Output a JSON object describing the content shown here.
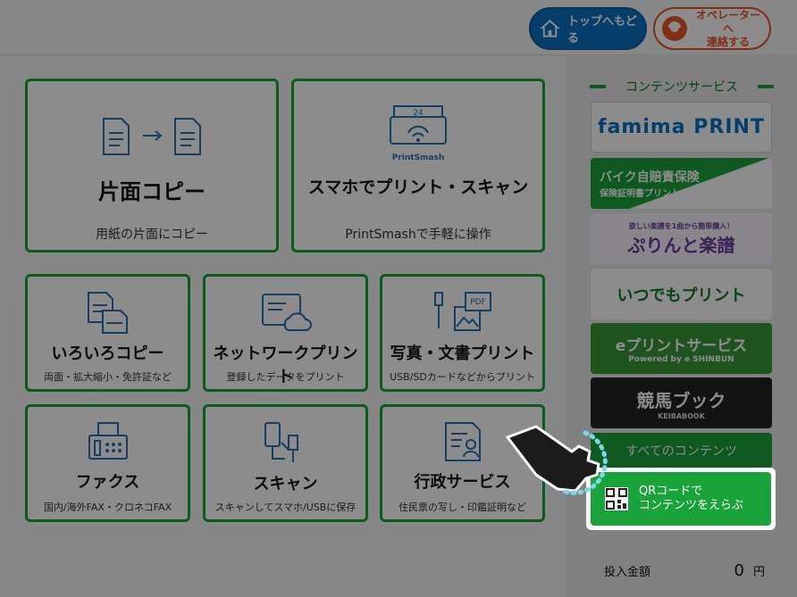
{
  "header": {
    "top_button": "トップへもどる",
    "operator_button_line1": "オペレーターへ",
    "operator_button_line2": "連絡する"
  },
  "tiles": [
    {
      "title": "片面コピー",
      "sub": "用紙の片面にコピー",
      "icon": "copy-document-icon"
    },
    {
      "title": "スマホでプリント・スキャン",
      "sub": "PrintSmashで手軽に操作",
      "icon": "printsmash-icon",
      "icon_label": "PrintSmash",
      "icon_number": "24"
    },
    {
      "title": "いろいろコピー",
      "sub": "両面・拡大縮小・免許証など",
      "icon": "multi-copy-icon"
    },
    {
      "title": "ネットワークプリント",
      "sub": "登録したデータをプリント",
      "icon": "cloud-print-icon"
    },
    {
      "title": "写真・文書プリント",
      "sub": "USB/SDカードなどからプリント",
      "icon": "photo-doc-icon",
      "icon_label": "PDF"
    },
    {
      "title": "ファクス",
      "sub": "国内/海外FAX・クロネコFAX",
      "icon": "fax-icon"
    },
    {
      "title": "スキャン",
      "sub": "スキャンしてスマホ/USBに保存",
      "icon": "scan-icon"
    },
    {
      "title": "行政サービス",
      "sub": "住民票の写し・印鑑証明など",
      "icon": "id-card-icon"
    }
  ],
  "content_services": {
    "title": "コンテンツサービス",
    "banners": [
      {
        "text": "famima PRINT",
        "colors": [
          "#ffffff",
          "#0b72c3",
          "#1aa33a"
        ]
      },
      {
        "text": "バイク自賠責保険",
        "text2": "保険証明書プリント"
      },
      {
        "text": "ぷりんと楽譜",
        "text2": "欲しい楽譜を1曲から簡単購入！"
      },
      {
        "text": "いつでもプリント"
      },
      {
        "text": "eプリントサービス",
        "text2": "Powered by e SHINBUN"
      },
      {
        "text": "競馬ブック",
        "text2": "KEIBABOOK"
      }
    ],
    "all_button": "すべてのコンテンツ",
    "qr_button_line1": "QRコードで",
    "qr_button_line2": "コンテンツをえらぶ"
  },
  "amount": {
    "label": "投入金額",
    "value": "0",
    "unit": "円"
  },
  "colors": {
    "green": "#1aa33a",
    "blue": "#0b72c3",
    "orange": "#e8542a"
  }
}
